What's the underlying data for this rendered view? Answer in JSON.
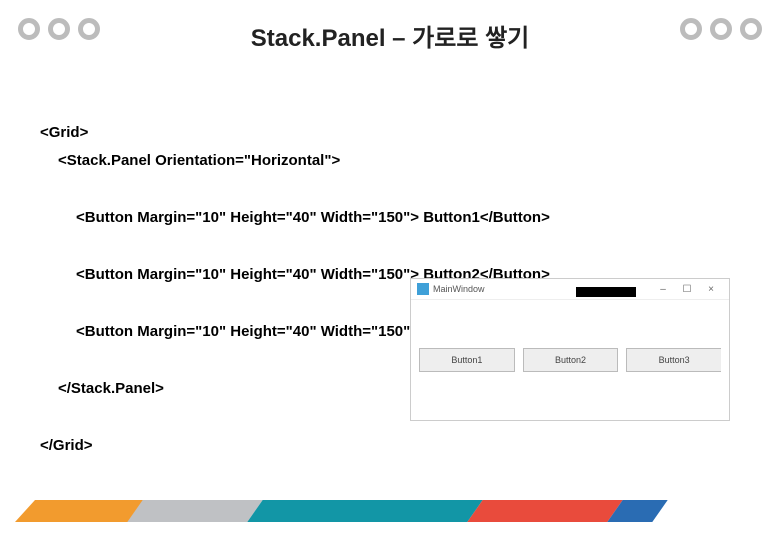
{
  "title": "Stack.Panel – 가로로 쌓기",
  "code": {
    "line1": "<Grid>",
    "line2": "<Stack.Panel Orientation=\"Horizontal\">",
    "line3": "<Button Margin=\"10\" Height=\"40\" Width=\"150\"> Button1</Button>",
    "line4": "<Button Margin=\"10\" Height=\"40\" Width=\"150\"> Button2</Button>",
    "line5": "<Button Margin=\"10\" Height=\"40\" Width=\"150\"> Button3</Button>",
    "line6": "</Stack.Panel>",
    "line7": "</Grid>"
  },
  "window": {
    "title": "MainWindow",
    "minimize": "–",
    "maximize": "☐",
    "close": "×",
    "buttons": [
      "Button1",
      "Button2",
      "Button3"
    ]
  }
}
